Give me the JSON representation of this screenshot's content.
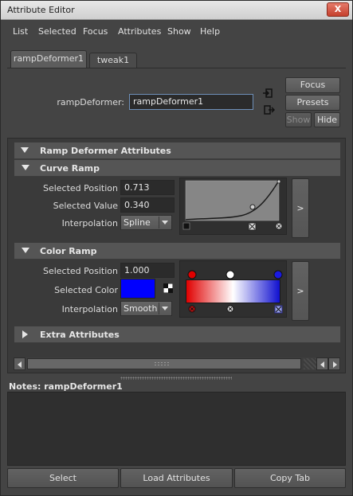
{
  "window": {
    "title": "Attribute Editor",
    "close_glyph": "X"
  },
  "menu": [
    "List",
    "Selected",
    "Focus",
    "Attributes",
    "Show",
    "Help"
  ],
  "tabs": [
    {
      "label": "rampDeformer1",
      "active": true
    },
    {
      "label": "tweak1",
      "active": false
    }
  ],
  "node": {
    "label": "rampDeformer:",
    "value": "rampDeformer1"
  },
  "side_buttons": {
    "focus": "Focus",
    "presets": "Presets",
    "show": "Show",
    "hide": "Hide"
  },
  "sections": {
    "ramp_deformer": "Ramp Deformer Attributes",
    "curve_ramp": "Curve Ramp",
    "color_ramp": "Color Ramp",
    "extra": "Extra Attributes"
  },
  "curve_ramp": {
    "position_label": "Selected Position",
    "position_value": "0.713",
    "value_label": "Selected Value",
    "value_value": "0.340",
    "interp_label": "Interpolation",
    "interp_value": "Spline",
    "expand_glyph": ">"
  },
  "color_ramp": {
    "position_label": "Selected Position",
    "position_value": "1.000",
    "color_label": "Selected Color",
    "selected_color": "#0000ff",
    "interp_label": "Interpolation",
    "interp_value": "Smooth",
    "expand_glyph": ">",
    "gradient": [
      "#e00000",
      "#ffffff",
      "#1010d0"
    ]
  },
  "notes": {
    "label": "Notes:  rampDeformer1"
  },
  "bottom": {
    "select": "Select",
    "load": "Load Attributes",
    "copy": "Copy Tab"
  }
}
